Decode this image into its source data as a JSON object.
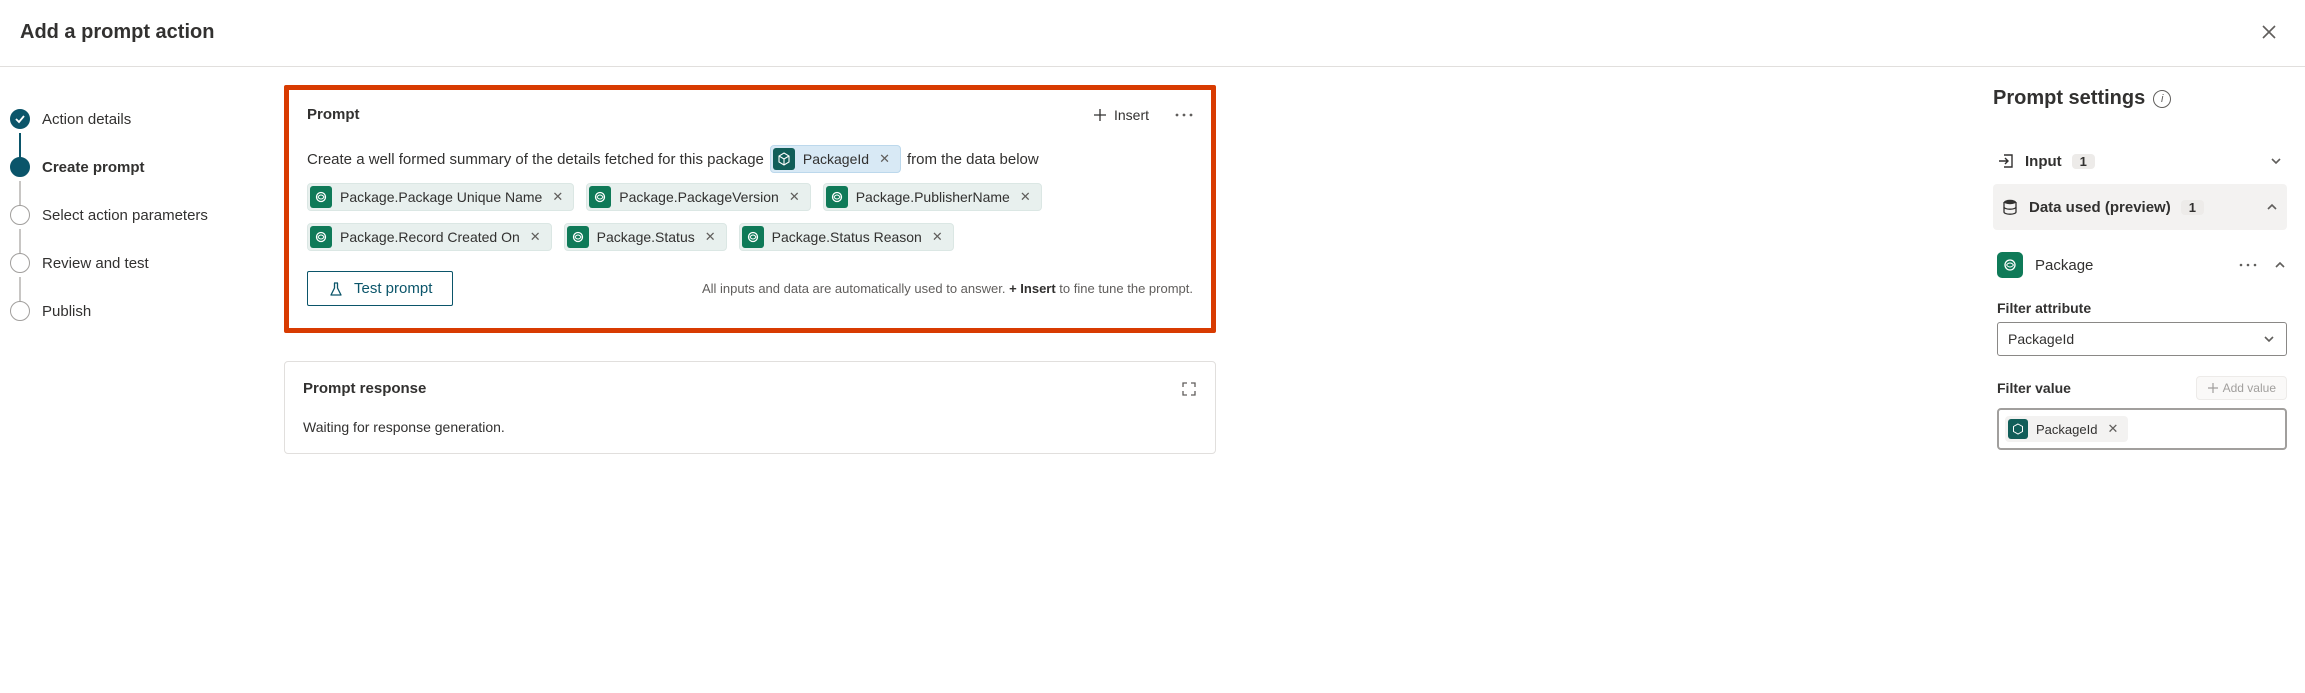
{
  "header": {
    "title": "Add a prompt action"
  },
  "steps": [
    {
      "label": "Action details"
    },
    {
      "label": "Create prompt"
    },
    {
      "label": "Select action parameters"
    },
    {
      "label": "Review and test"
    },
    {
      "label": "Publish"
    }
  ],
  "prompt": {
    "title": "Prompt",
    "insert_label": "Insert",
    "text_before": "Create a well formed summary of the details fetched for this package",
    "text_after": "from the data below",
    "inline_chip": "PackageId",
    "chips": [
      "Package.Package Unique Name",
      "Package.PackageVersion",
      "Package.PublisherName",
      "Package.Record Created On",
      "Package.Status",
      "Package.Status Reason"
    ],
    "test_label": "Test prompt",
    "hint_before": "All inputs and data are automatically used to answer. ",
    "hint_bold": "+ Insert",
    "hint_after": " to fine tune the prompt."
  },
  "response": {
    "title": "Prompt response",
    "body": "Waiting for response generation."
  },
  "settings": {
    "title": "Prompt settings",
    "input": {
      "label": "Input",
      "count": "1"
    },
    "data_used": {
      "label": "Data used (preview)",
      "count": "1"
    },
    "package_label": "Package",
    "filter_attr_label": "Filter attribute",
    "filter_attr_value": "PackageId",
    "filter_value_label": "Filter value",
    "add_value_label": "Add value",
    "filter_value_chip": "PackageId"
  }
}
